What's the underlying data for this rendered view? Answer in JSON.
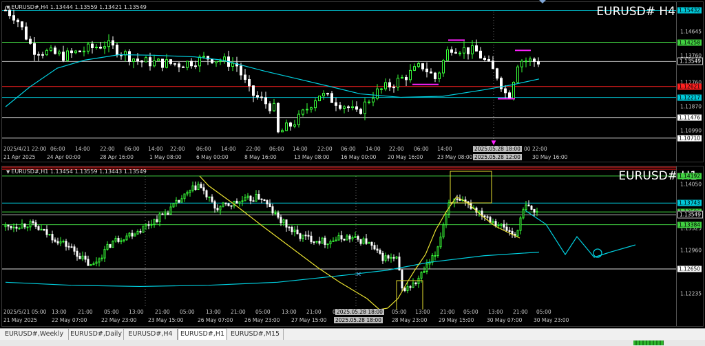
{
  "h4": {
    "ohlc": "EURUSD#,H4  1.13444 1.13559 1.13421 1.13549",
    "title": "EURUSD# H4",
    "ymin": 1.1045,
    "ymax": 1.1575,
    "price_labels": [
      {
        "value": "1.15432",
        "y": 1.15432,
        "bg": "#00c8d8",
        "fg": "#000"
      },
      {
        "value": "1.14258",
        "y": 1.14258,
        "bg": "#40d040",
        "fg": "#000"
      },
      {
        "value": "1.13549",
        "y": 1.13549,
        "bg": "#000",
        "fg": "#fff",
        "border": "#ccc"
      },
      {
        "value": "1.12621",
        "y": 1.12621,
        "bg": "#ff2020",
        "fg": "#000"
      },
      {
        "value": "1.12217",
        "y": 1.12217,
        "bg": "#00c8d8",
        "fg": "#000"
      },
      {
        "value": "1.11476",
        "y": 1.11476,
        "bg": "#fff",
        "fg": "#000"
      },
      {
        "value": "1.10710",
        "y": 1.1071,
        "bg": "#fff",
        "fg": "#000"
      }
    ],
    "axis_ticks": [
      "1.14645",
      "1.13760",
      "1.12760",
      "1.11870",
      "1.10990"
    ],
    "axis_tick_values": [
      1.14645,
      1.1376,
      1.1276,
      1.1187,
      1.1099
    ],
    "row1": [
      "2025/4/21 22:00",
      "06:00",
      "14:00",
      "22:00",
      "06:00",
      "14:00",
      "22:00",
      "06:00",
      "14:00",
      "22:00",
      "06:00",
      "14:00",
      "22:00",
      "06:00",
      "14:00",
      "22:00",
      "06:00",
      "14:00",
      "2025.05.28 18:00",
      "00",
      "22:00"
    ],
    "row2": [
      "21 Apr 2025",
      "24 Apr 00:00",
      "28 Apr 16:00",
      "1 May 08:00",
      "6 May 00:00",
      "8 May 16:00",
      "13 May 08:00",
      "16 May 00:00",
      "20 May 16:00",
      "23 May 08:00",
      "2025.05.28 12:00",
      "30 May 16:00"
    ]
  },
  "h1": {
    "ohlc": "EURUSD#,H1  1.13454 1.13559 1.13443 1.13549",
    "title": "EURUSD# H1",
    "ymin": 1.12,
    "ymax": 1.1435,
    "price_labels": [
      {
        "value": "1.14192",
        "y": 1.14192,
        "bg": "#40d040",
        "fg": "#000"
      },
      {
        "value": "1.13743",
        "y": 1.13743,
        "bg": "#00c8d8",
        "fg": "#000"
      },
      {
        "value": "1.13596",
        "y": 1.13596,
        "bg": "#40d040",
        "fg": "#000"
      },
      {
        "value": "1.13549",
        "y": 1.13549,
        "bg": "#000",
        "fg": "#fff",
        "border": "#ccc"
      },
      {
        "value": "1.13384",
        "y": 1.13384,
        "bg": "#40d040",
        "fg": "#000"
      },
      {
        "value": "1.12650",
        "y": 1.1265,
        "bg": "#fff",
        "fg": "#000"
      }
    ],
    "axis_ticks": [
      "1.14050",
      "1.13325",
      "1.12960",
      "1.12235"
    ],
    "axis_tick_values": [
      1.1405,
      1.13325,
      1.1296,
      1.12235
    ],
    "row1": [
      "2025/5/21 05:00",
      "13:00",
      "21:00",
      "05:00",
      "13:00",
      "21:00",
      "05:00",
      "13:00",
      "21:00",
      "05:00",
      "13:00",
      "21:00",
      "05:00",
      "13:00",
      "2025.05.28 18:00",
      "05:00",
      "13:00",
      "21:00",
      "05:00",
      "13:00",
      "21:00",
      "05:00"
    ],
    "row2": [
      "21 May 2025",
      "22 May 07:00",
      "22 May 23:00",
      "23 May 15:00",
      "26 May 07:00",
      "26 May 23:00",
      "27 May 15:00",
      "2025.05.28 18:00",
      "28 May 23:00",
      "29 May 15:00",
      "30 May 07:00",
      "30 May 23:00"
    ]
  },
  "tabs": [
    "EURUSD#,Weekly",
    "EURUSD#,Daily",
    "EURUSD#,H4",
    "EURUSD#,H1",
    "EURUSD#,M15"
  ],
  "active_tab": "EURUSD#,H1",
  "statusbar": {
    "left": "",
    "right": ""
  },
  "colors": {
    "bull": "#39ff39",
    "bear": "#ffffff",
    "ma": "#00d0e0",
    "trend": "#e8e030",
    "pink": "#ff20ff",
    "red": "#ff2020",
    "green_line": "#40d040"
  }
}
